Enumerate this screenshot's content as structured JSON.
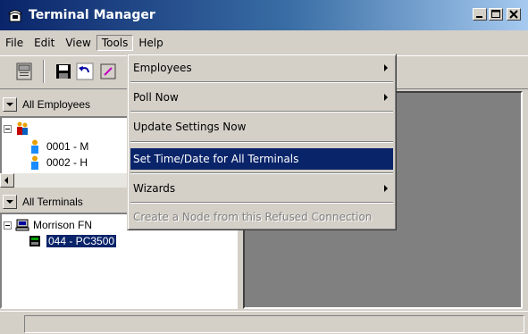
{
  "window": {
    "title": "Terminal Manager",
    "icon": "phone-icon"
  },
  "menubar": {
    "items": [
      "File",
      "Edit",
      "View",
      "Tools",
      "Help"
    ],
    "open_menu": "Tools"
  },
  "toolbar": {
    "tools": [
      "properties-icon",
      "save-icon",
      "undo-icon",
      "poll-icon"
    ]
  },
  "employees_group": {
    "label": "All Employees",
    "rows": [
      "0001 - M",
      "0002 - H"
    ]
  },
  "terminals_group": {
    "label": "All Terminals",
    "root": "Morrison FN",
    "rows": [
      "044 - PC3500"
    ]
  },
  "tools_menu": {
    "items": [
      {
        "label": "Employees",
        "submenu": true
      },
      {
        "label": "Poll Now",
        "submenu": true
      },
      {
        "label": "Update Settings Now",
        "submenu": false
      },
      {
        "label": "Set Time/Date for All Terminals",
        "submenu": false,
        "highlighted": true
      },
      {
        "label": "Wizards",
        "submenu": true
      },
      {
        "label": "Create a Node from this Refused Connection",
        "submenu": false,
        "disabled": true
      }
    ]
  },
  "colors": {
    "highlight": "#0a246a",
    "face": "#d4d0c8",
    "workspace": "#808080"
  }
}
